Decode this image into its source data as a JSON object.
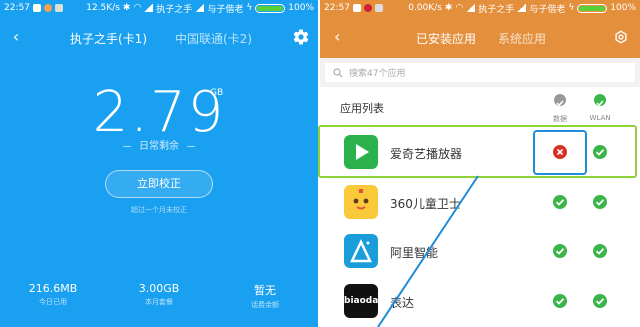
{
  "colors": {
    "left_bg": "#1aa0f0",
    "right_header": "#e48f3c",
    "green_check": "#3ab54a",
    "red_x": "#d93025",
    "highlight": "#8ed23a",
    "focus_box": "#1e8cd8"
  },
  "left": {
    "status": {
      "time": "22:57",
      "speed": "12.5K/s",
      "carrier1": "执子之手",
      "carrier2": "与子偕老",
      "battery": "100%",
      "battery_level": 1.0
    },
    "tabs": [
      "执子之手(卡1)",
      "中国联通(卡2)"
    ],
    "remaining_value": "2.79",
    "remaining_unit": "GB",
    "remaining_label": "日常剩余",
    "calibrate_button": "立即校正",
    "calibrate_hint": "超过一个月未校正",
    "stats": [
      {
        "value": "216.6MB",
        "label": "今日已用"
      },
      {
        "value": "3.00GB",
        "label": "本月套餐"
      },
      {
        "value": "暂无",
        "label": "话费余额"
      }
    ]
  },
  "right": {
    "status": {
      "time": "22:57",
      "speed": "0.00K/s",
      "carrier1": "执子之手",
      "carrier2": "与子偕老",
      "battery": "100%",
      "battery_level": 1.0
    },
    "tabs": [
      "已安装应用",
      "系统应用"
    ],
    "search_placeholder": "搜索47个应用",
    "list_title": "应用列表",
    "columns": [
      "数据",
      "WLAN"
    ],
    "apps": [
      {
        "name": "爱奇艺播放器",
        "icon": "iqiyi-icon",
        "data": false,
        "wlan": true
      },
      {
        "name": "360儿童卫士",
        "icon": "kids-guard-icon",
        "data": true,
        "wlan": true
      },
      {
        "name": "阿里智能",
        "icon": "ali-smart-icon",
        "data": true,
        "wlan": true
      },
      {
        "name": "表达",
        "icon": "biaoda-icon",
        "icon_text": "biaoda",
        "data": true,
        "wlan": true
      }
    ]
  }
}
